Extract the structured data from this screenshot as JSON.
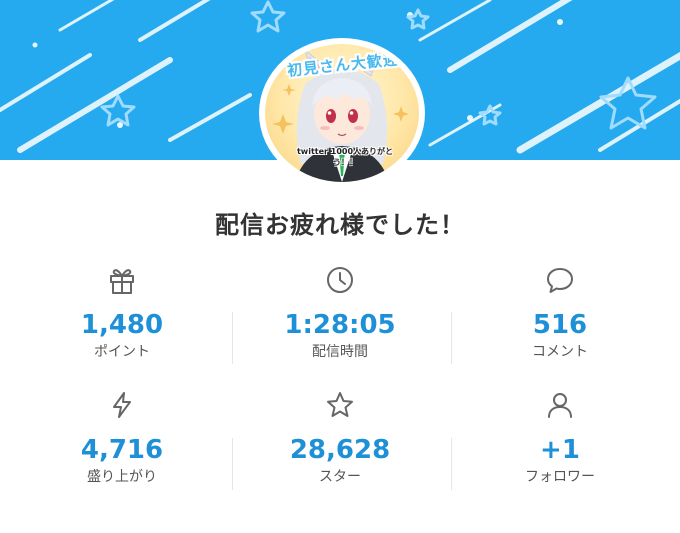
{
  "banner": {
    "color": "#25a9ef",
    "avatar_text": "初見さん大歓迎",
    "avatar_caption": "twitter 1000人ありがとう！！"
  },
  "title": "配信お疲れ様でした！",
  "stats": [
    {
      "icon": "gift-icon",
      "value": "1,480",
      "label": "ポイント"
    },
    {
      "icon": "clock-icon",
      "value": "1:28:05",
      "label": "配信時間"
    },
    {
      "icon": "comment-bubble-icon",
      "value": "516",
      "label": "コメント"
    },
    {
      "icon": "lightning-icon",
      "value": "4,716",
      "label": "盛り上がり"
    },
    {
      "icon": "star-icon",
      "value": "28,628",
      "label": "スター"
    },
    {
      "icon": "person-icon",
      "value": "+1",
      "label": "フォロワー"
    }
  ],
  "colors": {
    "value_blue": "#1e90d8",
    "icon_gray": "#666666",
    "label_gray": "#555555",
    "title": "#333333"
  }
}
